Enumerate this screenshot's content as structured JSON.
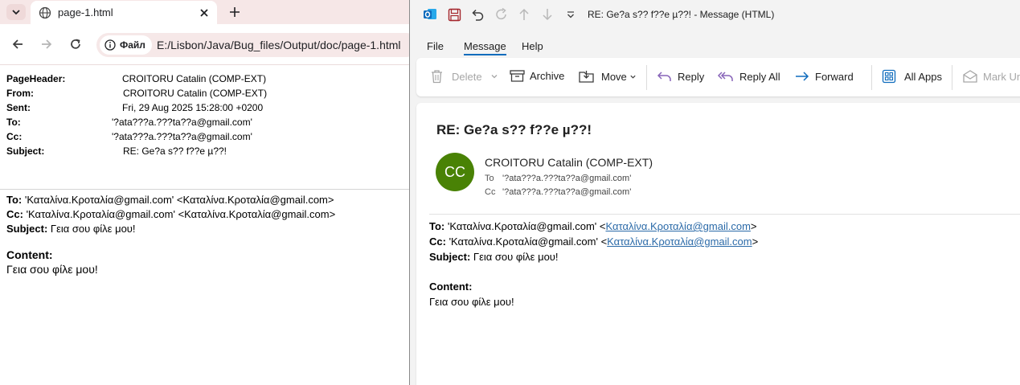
{
  "browser": {
    "tab_title": "page-1.html",
    "site_chip": "Файл",
    "url": "E:/Lisbon/Java/Bug_files/Output/doc/page-1.html"
  },
  "page": {
    "headers": [
      {
        "key": "PageHeader:",
        "value": "CROITORU Catalin (COMP-EXT)"
      },
      {
        "key": "From:",
        "value": "CROITORU Catalin (COMP-EXT)"
      },
      {
        "key": "Sent:",
        "value": "Fri, 29 Aug 2025 15:28:00 +0200"
      },
      {
        "key": "To:",
        "value": "'?ata???a.???ta??a@gmail.com'"
      },
      {
        "key": "Cc:",
        "value": "'?ata???a.???ta??a@gmail.com'"
      },
      {
        "key": "Subject:",
        "value": "RE: Ge?a s?? f??e µ??!"
      }
    ],
    "to_label": "To:",
    "to_value": " 'Καταλίνα.Κροταλία@gmail.com' <Καταλίνα.Κροταλία@gmail.com>",
    "cc_label": "Cc:",
    "cc_value": " 'Καταλίνα.Κροταλία@gmail.com' <Καταλίνα.Κροταλία@gmail.com>",
    "subject_label": "Subject:",
    "subject_value": " Γεια σου φίλε μου!",
    "content_label": "Content:",
    "content_value": "Γεια σου φίλε μου!"
  },
  "outlook": {
    "window_title": "RE: Ge?a s?? f??e µ??!  -  Message (HTML)",
    "menu": [
      "File",
      "Message",
      "Help"
    ],
    "ribbon": {
      "delete": "Delete",
      "archive": "Archive",
      "move": "Move",
      "reply": "Reply",
      "reply_all": "Reply All",
      "forward": "Forward",
      "all_apps": "All Apps",
      "mark_unread": "Mark Unr"
    },
    "message": {
      "subject": "RE: Ge?a s?? f??e µ??!",
      "avatar_initials": "CC",
      "sender": "CROITORU Catalin (COMP-EXT)",
      "to_label": "To",
      "to_value": "'?ata???a.???ta??a@gmail.com'",
      "cc_label": "Cc",
      "cc_value": "'?ata???a.???ta??a@gmail.com'",
      "body_to_label": "To:",
      "body_to_name": " 'Καταλίνα.Κροταλία@gmail.com' <",
      "body_to_link": "Καταλίνα.Κροταλία@gmail.com",
      "body_cc_label": "Cc:",
      "body_cc_name": " 'Καταλίνα.Κροταλία@gmail.com' <",
      "body_cc_link": "Καταλίνα.Κροταλία@gmail.com",
      "close_bracket": ">",
      "body_subject_label": "Subject:",
      "body_subject_value": " Γεια σου φίλε μου!",
      "body_content_label": "Content:",
      "body_content_value": "Γεια σου φίλε μου!"
    }
  },
  "colors": {
    "tabstrip": "#f6e7e7",
    "avatar": "#498205",
    "accent": "#0f6cbd",
    "link": "#2b6aa8"
  }
}
